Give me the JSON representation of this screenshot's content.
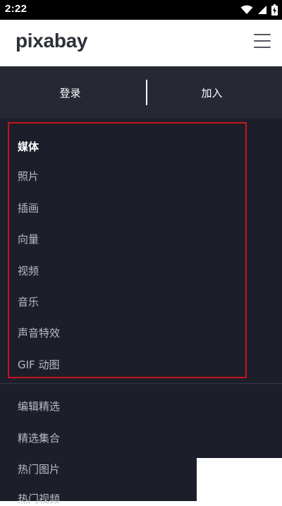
{
  "status_bar": {
    "time": "2:22",
    "icons": [
      "wifi-icon",
      "cellular-signal-icon",
      "battery-charging-icon"
    ]
  },
  "header": {
    "logo_text": "pixabay",
    "menu_icon": "hamburger-menu-icon"
  },
  "auth": {
    "login_label": "登录",
    "join_label": "加入"
  },
  "media": {
    "heading": "媒体",
    "items": [
      {
        "label": "照片"
      },
      {
        "label": "插画"
      },
      {
        "label": "向量"
      },
      {
        "label": "视频"
      },
      {
        "label": "音乐"
      },
      {
        "label": "声音特效"
      },
      {
        "label": "GIF 动图"
      }
    ]
  },
  "more": {
    "items": [
      {
        "label": "编辑精选"
      },
      {
        "label": "精选集合"
      },
      {
        "label": "热门图片"
      },
      {
        "label": "热门视频"
      }
    ]
  },
  "colors": {
    "drawer_background": "#1c1e2a",
    "auth_background": "#262834",
    "highlight_border": "#c4161c",
    "nav_text": "#b9bcc6",
    "logo": "#2e3138"
  }
}
